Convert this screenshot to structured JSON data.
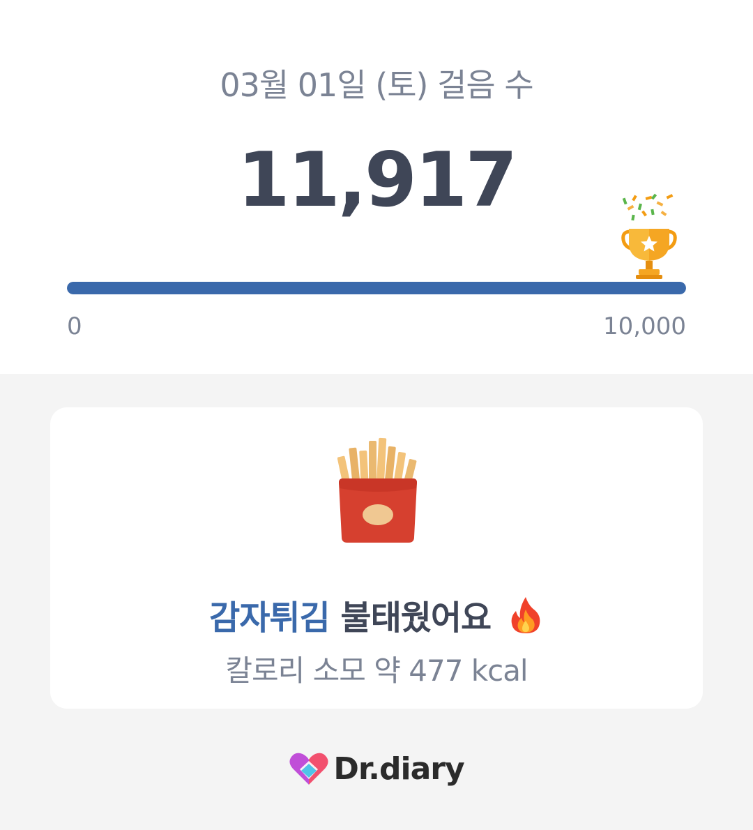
{
  "header": {
    "date_title": "03월 01일 (토) 걸음 수",
    "step_count": "11,917"
  },
  "progress": {
    "min_label": "0",
    "max_label": "10,000",
    "fill_percent": 100,
    "color": "#3a69ab"
  },
  "icons": {
    "trophy": "trophy-icon",
    "confetti": "confetti-icon",
    "fries": "french-fries-icon",
    "flame": "fire-icon",
    "logo": "heart-logo-icon"
  },
  "card": {
    "food_name": "감자튀김",
    "burn_text": " 불태웠어요",
    "kcal_text": "칼로리 소모 약 477 kcal"
  },
  "brand": {
    "name": "Dr.diary"
  },
  "colors": {
    "accent": "#3a69ab",
    "text_dark": "#3f4657",
    "text_gray": "#7b8394",
    "background": "#f4f4f4"
  }
}
